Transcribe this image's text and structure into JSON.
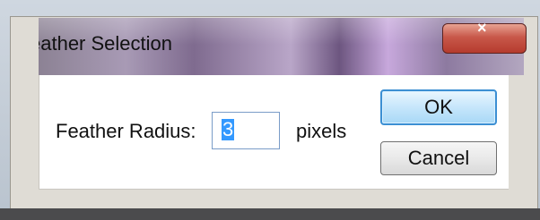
{
  "dialog": {
    "title": "eather Selection",
    "close_symbol": "×",
    "field_label": "Feather Radius:",
    "radius_value": "3",
    "units": "pixels",
    "ok_label": "OK",
    "cancel_label": "Cancel"
  },
  "icons": {
    "close": "close-icon"
  },
  "colors": {
    "ok_border": "#3c8fd3",
    "selection": "#3399ff",
    "close_button": "#c8584a"
  }
}
